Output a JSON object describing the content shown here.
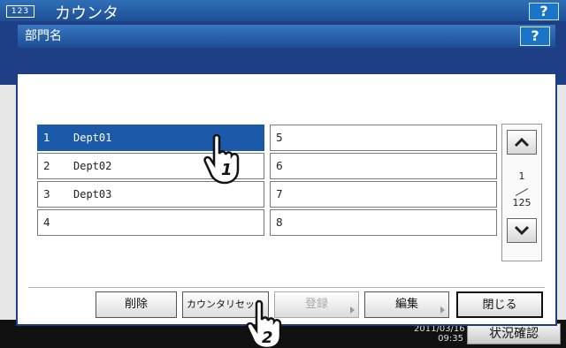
{
  "background": {
    "badge": "123",
    "title": "カウンタ",
    "help": "?",
    "clock": "2011/03/16\n09:35",
    "status_button": "状況確認"
  },
  "dialog": {
    "title": "部門名",
    "help": "?",
    "list": [
      {
        "num": "1",
        "name": "Dept01",
        "selected": true
      },
      {
        "num": "2",
        "name": "Dept02"
      },
      {
        "num": "3",
        "name": "Dept03"
      },
      {
        "num": "4",
        "name": ""
      },
      {
        "num": "5",
        "name": ""
      },
      {
        "num": "6",
        "name": ""
      },
      {
        "num": "7",
        "name": ""
      },
      {
        "num": "8",
        "name": ""
      }
    ],
    "pager": {
      "current": "1",
      "total": "125"
    },
    "buttons": {
      "delete": "削除",
      "reset": "カウンタリセット",
      "register": "登録",
      "edit": "編集",
      "close": "閉じる"
    }
  },
  "callouts": {
    "first": "1",
    "second": "2"
  },
  "colors": {
    "accent": "#1e3f85",
    "selected": "#1a5aa8"
  }
}
